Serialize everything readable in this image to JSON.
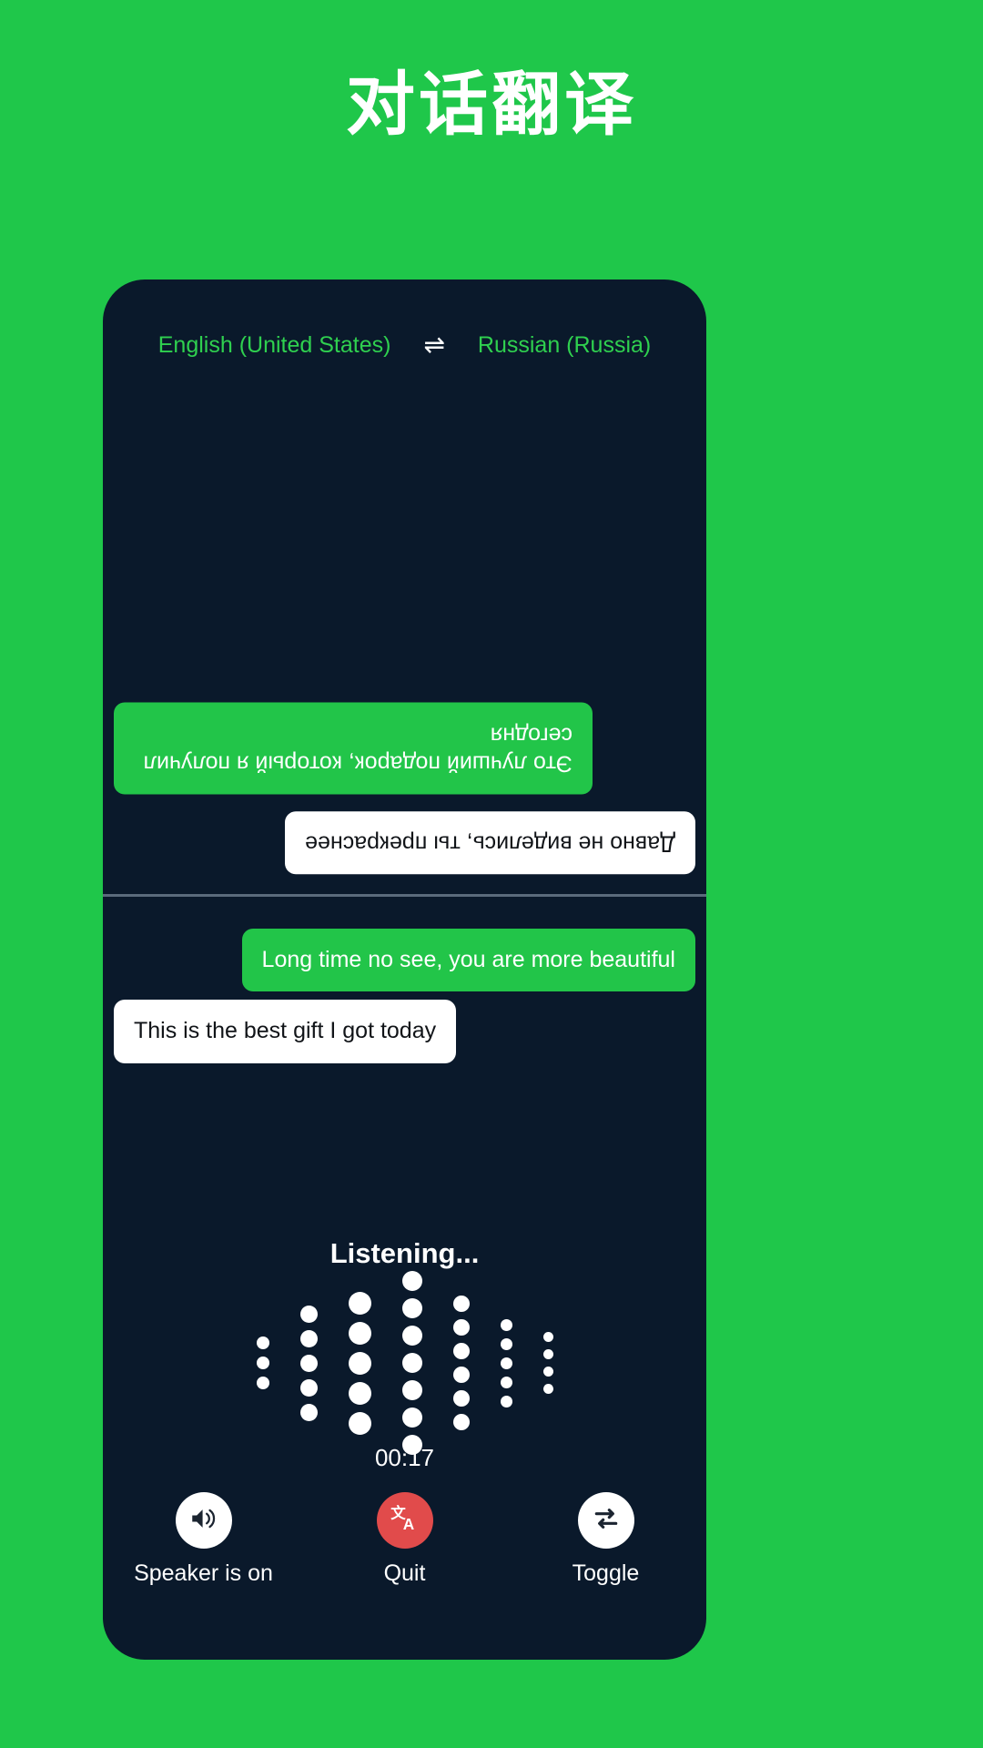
{
  "page": {
    "title": "对话翻译",
    "background_color": "#1fc74a"
  },
  "card": {
    "background_color": "#0a192b",
    "accent_green": "#22c549",
    "quit_red": "#e14b4b"
  },
  "language_bar": {
    "source": "English (United States)",
    "swap_icon": "⇌",
    "swap_icon_name": "swap-languages-icon",
    "target": "Russian (Russia)"
  },
  "conversation": {
    "top_pane": {
      "rotated": true,
      "messages": [
        {
          "text": "Это лучший подарок, который я получил сегодня",
          "style": "green",
          "align": "right"
        },
        {
          "text": "Давно не виделись, ты прекраснее",
          "style": "white",
          "align": "left"
        }
      ]
    },
    "bottom_pane": {
      "rotated": false,
      "messages": [
        {
          "text": "Long time no see, you are more beautiful",
          "style": "green",
          "align": "right"
        },
        {
          "text": "This is the best gift I got today",
          "style": "white",
          "align": "left"
        }
      ]
    }
  },
  "status": {
    "listening_label": "Listening...",
    "timer": "00:17"
  },
  "waveform": {
    "columns": [
      {
        "dots": 3,
        "size": 14
      },
      {
        "dots": 5,
        "size": 19
      },
      {
        "dots": 5,
        "size": 25
      },
      {
        "dots": 7,
        "size": 22
      },
      {
        "dots": 6,
        "size": 18
      },
      {
        "dots": 5,
        "size": 13
      },
      {
        "dots": 4,
        "size": 11
      }
    ]
  },
  "controls": [
    {
      "label": "Speaker is on",
      "icon": "speaker-on-icon",
      "circle_color": "#ffffff",
      "name": "speaker-button"
    },
    {
      "label": "Quit",
      "icon": "translate-icon",
      "circle_color": "#e14b4b",
      "name": "quit-button"
    },
    {
      "label": "Toggle",
      "icon": "swap-repeat-icon",
      "circle_color": "#ffffff",
      "name": "toggle-button"
    }
  ]
}
